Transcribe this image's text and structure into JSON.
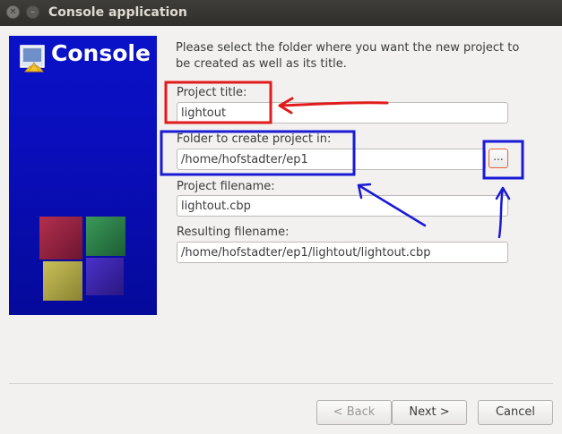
{
  "window": {
    "title": "Console application",
    "close_glyph": "✕",
    "minimize_glyph": "–"
  },
  "banner": {
    "text": "Console"
  },
  "intro": {
    "text": "Please select the folder where you want the new project to be created as well as its title."
  },
  "form": {
    "project_title_label": "Project title:",
    "project_title_value": "lightout",
    "folder_label": "Folder to create project in:",
    "folder_value": "/home/hofstadter/ep1",
    "browse_label": "...",
    "filename_label": "Project filename:",
    "filename_value": "lightout.cbp",
    "resulting_label": "Resulting filename:",
    "resulting_value": "/home/hofstadter/ep1/lightout/lightout.cbp"
  },
  "buttons": {
    "back": "< Back",
    "next": "Next >",
    "cancel": "Cancel"
  },
  "colors": {
    "annotation_red": "#e11b1b",
    "annotation_blue": "#1a1ad6",
    "banner_blue": "#0a0ebb",
    "browse_border": "#e0633a"
  }
}
